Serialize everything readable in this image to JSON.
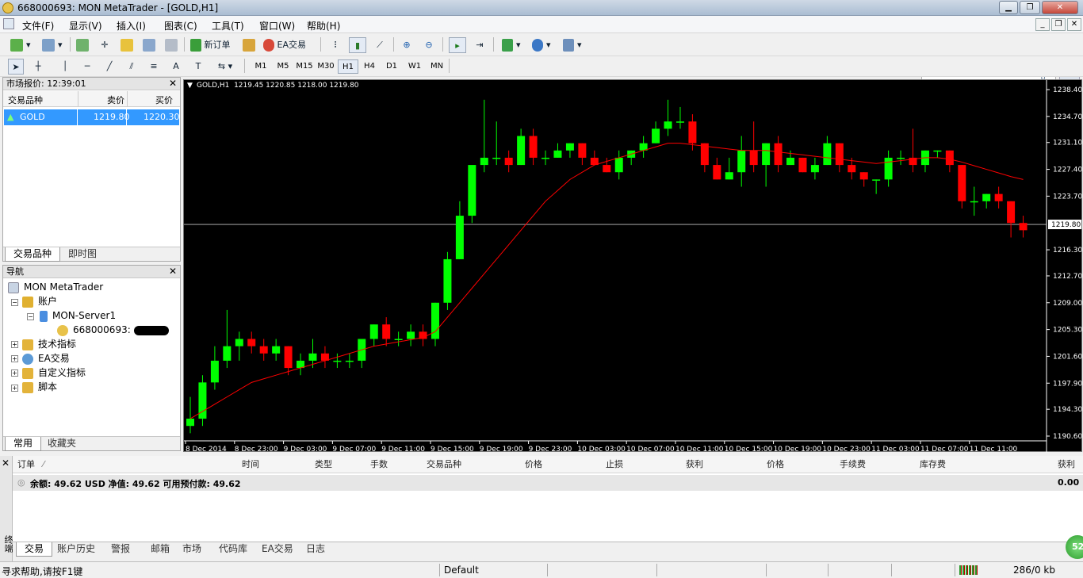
{
  "window": {
    "title": "668000693: MON MetaTrader - [GOLD,H1]"
  },
  "menu": [
    "文件(F)",
    "显示(V)",
    "插入(I)",
    "图表(C)",
    "工具(T)",
    "窗口(W)",
    "帮助(H)"
  ],
  "toolbar": {
    "new_order": "新订单",
    "ea_trading": "EA交易"
  },
  "timeframes": [
    "M1",
    "M5",
    "M15",
    "M30",
    "H1",
    "H4",
    "D1",
    "W1",
    "MN"
  ],
  "active_timeframe": "H1",
  "market_watch": {
    "title": "市场报价: 12:39:01",
    "columns": [
      "交易品种",
      "卖价",
      "买价"
    ],
    "rows": [
      {
        "symbol": "GOLD",
        "bid": "1219.80",
        "ask": "1220.30"
      }
    ],
    "tabs": [
      "交易品种",
      "即时图"
    ]
  },
  "navigator": {
    "title": "导航",
    "root": "MON MetaTrader",
    "accounts": "账户",
    "server": "MON-Server1",
    "account_id": "668000693:",
    "indicators": "技术指标",
    "experts": "EA交易",
    "custom_indicators": "自定义指标",
    "scripts": "脚本",
    "tabs": [
      "常用",
      "收藏夹"
    ]
  },
  "chart": {
    "header": "GOLD,H1  1219.45 1220.85 1218.00 1219.80",
    "current_price": "1219.80",
    "price_ticks": [
      "1238.40",
      "1234.70",
      "1231.10",
      "1227.40",
      "1223.70",
      "1216.30",
      "1212.70",
      "1209.00",
      "1205.30",
      "1201.60",
      "1197.90",
      "1194.30",
      "1190.60"
    ],
    "time_ticks": [
      "8 Dec 2014",
      "8 Dec 23:00",
      "9 Dec 03:00",
      "9 Dec 07:00",
      "9 Dec 11:00",
      "9 Dec 15:00",
      "9 Dec 19:00",
      "9 Dec 23:00",
      "10 Dec 03:00",
      "10 Dec 07:00",
      "10 Dec 11:00",
      "10 Dec 15:00",
      "10 Dec 19:00",
      "10 Dec 23:00",
      "11 Dec 03:00",
      "11 Dec 07:00",
      "11 Dec 11:00"
    ],
    "colors": {
      "bull": "#00ff00",
      "bear": "#ff0000",
      "ma": "#ff0000",
      "bg": "#000000"
    }
  },
  "chart_data": {
    "type": "candlestick",
    "symbol": "GOLD",
    "timeframe": "H1",
    "ylim": [
      1190.6,
      1238.4
    ],
    "candles": [
      [
        1192,
        1196,
        1191,
        1193
      ],
      [
        1193,
        1199,
        1192,
        1198
      ],
      [
        1198,
        1203,
        1197,
        1201
      ],
      [
        1201,
        1208,
        1200,
        1203
      ],
      [
        1203,
        1205,
        1201,
        1204
      ],
      [
        1204,
        1205,
        1202,
        1203
      ],
      [
        1203,
        1204,
        1201,
        1202
      ],
      [
        1202,
        1204,
        1201,
        1203
      ],
      [
        1203,
        1203,
        1199,
        1200
      ],
      [
        1200,
        1202,
        1199,
        1201
      ],
      [
        1201,
        1204,
        1200,
        1202
      ],
      [
        1202,
        1203,
        1200,
        1201
      ],
      [
        1201,
        1202,
        1200,
        1201
      ],
      [
        1201,
        1202,
        1200,
        1201
      ],
      [
        1201,
        1204,
        1200,
        1204
      ],
      [
        1204,
        1206,
        1203,
        1206
      ],
      [
        1206,
        1207,
        1203,
        1204
      ],
      [
        1204,
        1205,
        1203,
        1204
      ],
      [
        1204,
        1206,
        1203,
        1205
      ],
      [
        1205,
        1206,
        1203,
        1204
      ],
      [
        1204,
        1209,
        1203,
        1209
      ],
      [
        1209,
        1216,
        1208,
        1215
      ],
      [
        1215,
        1223,
        1215,
        1221
      ],
      [
        1221,
        1226,
        1220,
        1228
      ],
      [
        1228,
        1237,
        1227,
        1229
      ],
      [
        1229,
        1234,
        1228,
        1229
      ],
      [
        1229,
        1230,
        1227,
        1228
      ],
      [
        1228,
        1233,
        1228,
        1232
      ],
      [
        1232,
        1233,
        1228,
        1229
      ],
      [
        1229,
        1230,
        1228,
        1229
      ],
      [
        1229,
        1231,
        1229,
        1230
      ],
      [
        1230,
        1231,
        1229,
        1231
      ],
      [
        1231,
        1231,
        1228,
        1229
      ],
      [
        1229,
        1230,
        1228,
        1228
      ],
      [
        1228,
        1229,
        1227,
        1227
      ],
      [
        1227,
        1230,
        1226,
        1229
      ],
      [
        1229,
        1230,
        1228,
        1230
      ],
      [
        1230,
        1232,
        1229,
        1231
      ],
      [
        1231,
        1234,
        1231,
        1233
      ],
      [
        1233,
        1237,
        1232,
        1234
      ],
      [
        1234,
        1236,
        1233,
        1234
      ],
      [
        1234,
        1235,
        1230,
        1231
      ],
      [
        1231,
        1231,
        1227,
        1228
      ],
      [
        1228,
        1229,
        1226,
        1226
      ],
      [
        1226,
        1229,
        1226,
        1227
      ],
      [
        1227,
        1232,
        1225,
        1230
      ],
      [
        1230,
        1234,
        1227,
        1228
      ],
      [
        1228,
        1231,
        1225,
        1231
      ],
      [
        1231,
        1232,
        1227,
        1228
      ],
      [
        1228,
        1230,
        1228,
        1229
      ],
      [
        1229,
        1229,
        1227,
        1227
      ],
      [
        1227,
        1229,
        1226,
        1228
      ],
      [
        1228,
        1232,
        1228,
        1231
      ],
      [
        1231,
        1231,
        1227,
        1228
      ],
      [
        1228,
        1229,
        1226,
        1227
      ],
      [
        1227,
        1227,
        1225,
        1226
      ],
      [
        1226,
        1226,
        1224,
        1226
      ],
      [
        1226,
        1230,
        1225,
        1229
      ],
      [
        1229,
        1230,
        1228,
        1229
      ],
      [
        1229,
        1233,
        1227,
        1228
      ],
      [
        1228,
        1230,
        1227,
        1230
      ],
      [
        1230,
        1230,
        1229,
        1230
      ],
      [
        1230,
        1230,
        1227,
        1228
      ],
      [
        1228,
        1228,
        1222,
        1223
      ],
      [
        1223,
        1225,
        1221,
        1223
      ],
      [
        1223,
        1224,
        1222,
        1224
      ],
      [
        1224,
        1225,
        1222,
        1223
      ],
      [
        1223,
        1223,
        1218,
        1220
      ],
      [
        1220,
        1221,
        1218,
        1219
      ]
    ],
    "ma": [
      1193,
      1194,
      1195,
      1196,
      1197,
      1198,
      1198.5,
      1199,
      1199.5,
      1200,
      1200.5,
      1201,
      1201.5,
      1202,
      1202.5,
      1203,
      1203.3,
      1203.6,
      1203.9,
      1204.2,
      1205,
      1207,
      1209,
      1211,
      1213,
      1215,
      1217,
      1219,
      1221,
      1223,
      1224.5,
      1226,
      1227,
      1228,
      1228.5,
      1229,
      1229.5,
      1230,
      1230.5,
      1231,
      1231,
      1230.8,
      1230.6,
      1230.4,
      1230.2,
      1230,
      1230,
      1230,
      1229.8,
      1229.6,
      1229.4,
      1229.2,
      1229,
      1228.8,
      1228.6,
      1228.4,
      1228.2,
      1228.4,
      1228.6,
      1228.8,
      1229,
      1229,
      1228.8,
      1228.4,
      1227.9,
      1227.4,
      1226.9,
      1226.4,
      1226
    ]
  },
  "terminal": {
    "columns": [
      "订单",
      "时间",
      "类型",
      "手数",
      "交易品种",
      "价格",
      "止损",
      "获利",
      "价格",
      "手续费",
      "库存费",
      "获利"
    ],
    "balance_line": "余额: 49.62 USD  净值: 49.62  可用预付款: 49.62",
    "balance_profit": "0.00",
    "side_label": "终端",
    "tabs": [
      "交易",
      "账户历史",
      "警报",
      "邮箱",
      "市场",
      "代码库",
      "EA交易",
      "日志"
    ]
  },
  "status": {
    "help": "寻求帮助,请按F1键",
    "profile": "Default",
    "traffic": "286/0 kb",
    "badge": "52"
  }
}
